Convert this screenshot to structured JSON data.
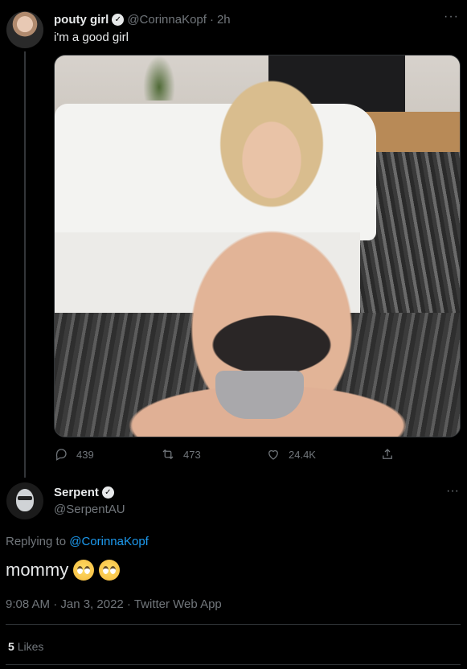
{
  "tweet": {
    "display_name": "pouty girl",
    "handle": "@CorinnaKopf",
    "separator": "·",
    "time": "2h",
    "text": "i'm a good girl",
    "more": "···",
    "stats": {
      "replies": "439",
      "retweets": "473",
      "likes": "24.4K"
    }
  },
  "reply": {
    "display_name": "Serpent",
    "handle": "@SerpentAU",
    "more": "···",
    "replying_prefix": "Replying to",
    "replying_to": "@CorinnaKopf",
    "text": "mommy",
    "emojis": [
      "face-with-rolling-eyes",
      "face-with-rolling-eyes"
    ],
    "meta": "9:08 AM · Jan 3, 2022 · Twitter Web App",
    "like_count": "5",
    "like_label": "Likes"
  },
  "colors": {
    "background": "#000000",
    "text": "#e7e9ea",
    "muted": "#71767b",
    "link": "#1d9bf0",
    "border": "#2f3336"
  }
}
